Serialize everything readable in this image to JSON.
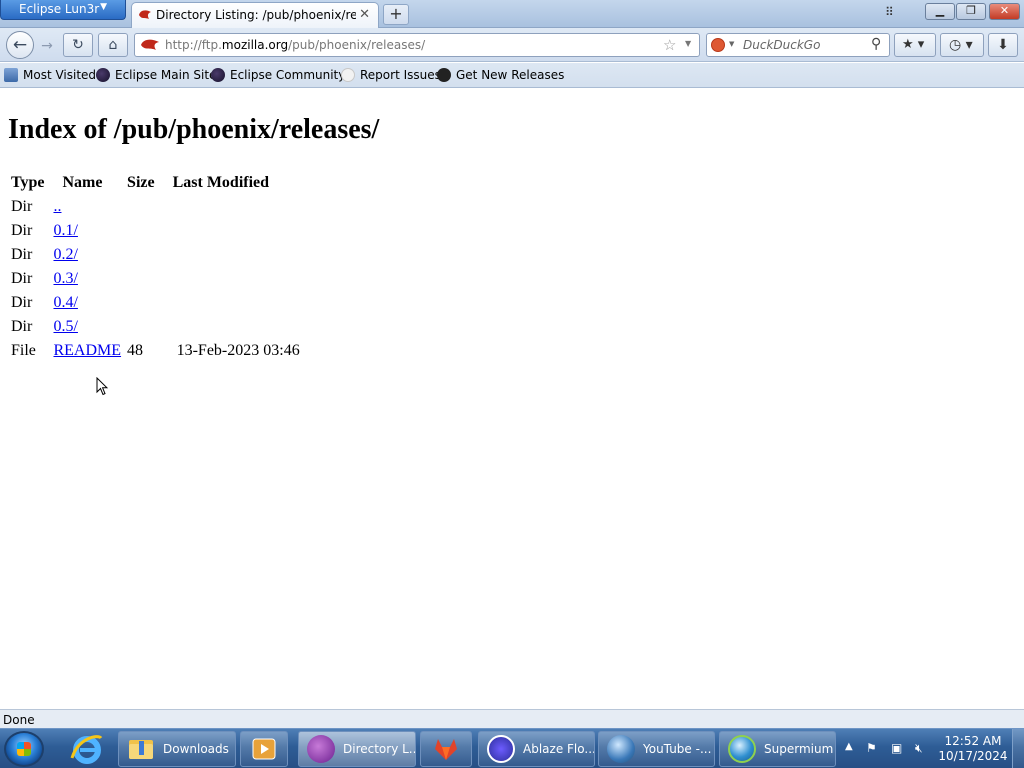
{
  "browser": {
    "app_menu_label": "Eclipse Lun3r",
    "tab_title": "Directory Listing: /pub/phoenix/releases/",
    "url_prefix": "http://ftp.",
    "url_domain": "mozilla.org",
    "url_path": "/pub/phoenix/releases/",
    "search_placeholder": "DuckDuckGo",
    "bookmarks": [
      {
        "label": "Most Visited",
        "icon": "most-visited-icon"
      },
      {
        "label": "Eclipse Main Site",
        "icon": "eclipse-moon-icon"
      },
      {
        "label": "Eclipse Community",
        "icon": "eclipse-moon-icon"
      },
      {
        "label": "Report Issues",
        "icon": "github-icon"
      },
      {
        "label": "Get New Releases",
        "icon": "github-icon"
      }
    ],
    "status_text": "Done"
  },
  "page": {
    "title": "Index of /pub/phoenix/releases/",
    "headers": [
      "Type",
      "Name",
      "Size",
      "Last Modified"
    ],
    "rows": [
      {
        "type": "Dir",
        "name": "..",
        "size": "",
        "modified": ""
      },
      {
        "type": "Dir",
        "name": "0.1/",
        "size": "",
        "modified": ""
      },
      {
        "type": "Dir",
        "name": "0.2/",
        "size": "",
        "modified": ""
      },
      {
        "type": "Dir",
        "name": "0.3/",
        "size": "",
        "modified": ""
      },
      {
        "type": "Dir",
        "name": "0.4/",
        "size": "",
        "modified": ""
      },
      {
        "type": "Dir",
        "name": "0.5/",
        "size": "",
        "modified": ""
      },
      {
        "type": "File",
        "name": "README",
        "size": "48",
        "modified": "13-Feb-2023 03:46"
      }
    ]
  },
  "taskbar": {
    "items": [
      {
        "label": "Downloads",
        "icon": "folder-icon"
      },
      {
        "label": "Directory L...",
        "icon": "browser-icon"
      },
      {
        "label": "Ablaze Flo...",
        "icon": "ablaze-icon"
      },
      {
        "label": "YouTube -...",
        "icon": "globe-user-icon"
      },
      {
        "label": "Supermium",
        "icon": "globe-icon"
      }
    ],
    "time": "12:52 AM",
    "date": "10/17/2024"
  },
  "colors": {
    "link": "#0000ee",
    "taskbar": "#2e5d96",
    "chrome": "#cfdcee",
    "app_menu": "#2a6bc4"
  }
}
